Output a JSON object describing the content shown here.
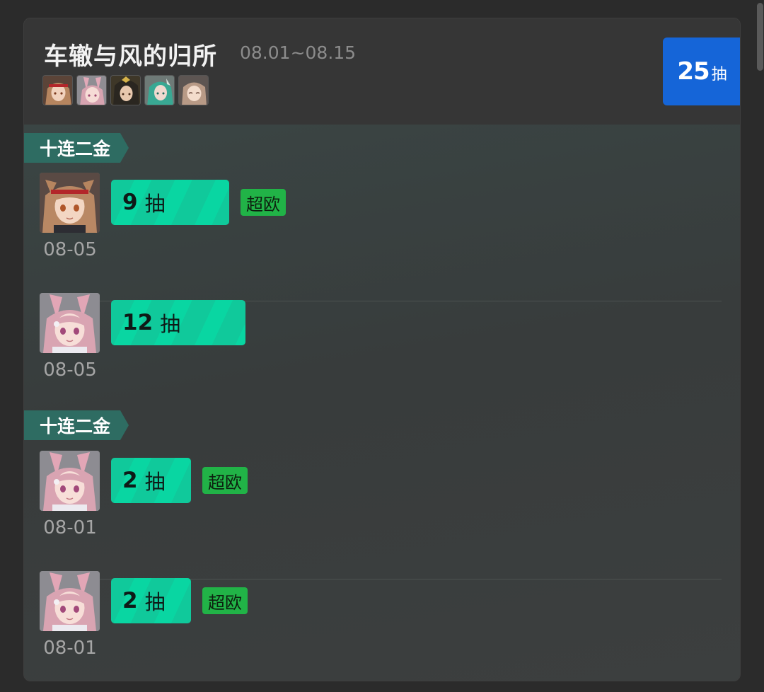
{
  "pool": {
    "title": "车辙与风的归所",
    "dates": "08.01~08.15",
    "operators": [
      {
        "icon": "operator-brown-hair"
      },
      {
        "icon": "operator-pink-hair"
      },
      {
        "icon": "operator-dark-hood"
      },
      {
        "icon": "operator-green-hair"
      },
      {
        "icon": "operator-light-brown-hair"
      }
    ],
    "total": {
      "count": "25",
      "unit": "抽"
    }
  },
  "sections": [
    {
      "tag": "十连二金",
      "pulls": [
        {
          "count": "9",
          "unit": "抽",
          "date": "08-05",
          "badge": "超欧",
          "avatar": "operator-brown-hair"
        },
        {
          "count": "12",
          "unit": "抽",
          "date": "08-05",
          "badge": "",
          "avatar": "operator-pink-hair"
        }
      ]
    },
    {
      "tag": "十连二金",
      "pulls": [
        {
          "count": "2",
          "unit": "抽",
          "date": "08-01",
          "badge": "超欧",
          "avatar": "operator-pink-hair"
        },
        {
          "count": "2",
          "unit": "抽",
          "date": "08-01",
          "badge": "超欧",
          "avatar": "operator-pink-hair"
        }
      ]
    }
  ],
  "colors": {
    "accent_blue": "#1565d8",
    "pull_green": "#10c99b",
    "luck_green": "#21b347",
    "tag_teal": "#2e6c62"
  }
}
